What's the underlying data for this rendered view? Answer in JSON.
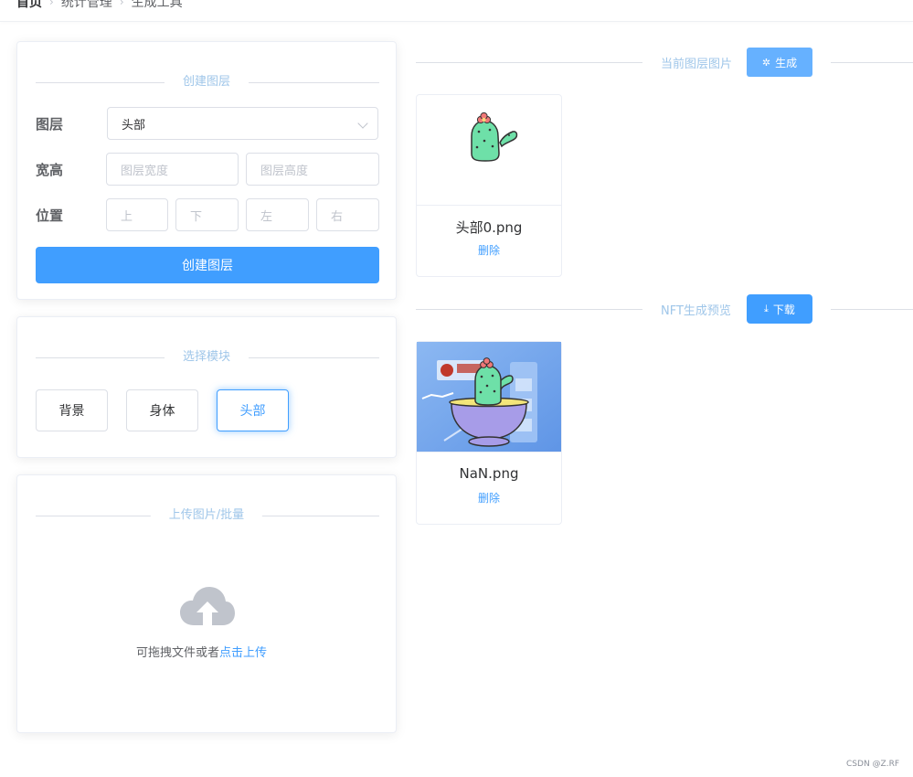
{
  "breadcrumb": {
    "home": "首页",
    "items": [
      "统计管理",
      "生成工具"
    ]
  },
  "create_layer": {
    "section_title": "创建图层",
    "layer_label": "图层",
    "layer_value": "头部",
    "size_label": "宽高",
    "width_placeholder": "图层宽度",
    "height_placeholder": "图层高度",
    "position_label": "位置",
    "pos_top": "上",
    "pos_bottom": "下",
    "pos_left": "左",
    "pos_right": "右",
    "create_button": "创建图层"
  },
  "select_module": {
    "section_title": "选择模块",
    "buttons": [
      "背景",
      "身体",
      "头部"
    ],
    "active": "头部"
  },
  "upload": {
    "section_title": "上传图片/批量",
    "hint": "可拖拽文件或者",
    "link": "点击上传"
  },
  "current_layer": {
    "section_title": "当前图层图片",
    "generate_button": "生成",
    "image_name": "头部0.png",
    "delete": "删除"
  },
  "preview": {
    "section_title": "NFT生成预览",
    "download_button": "下载",
    "image_name": "NaN.png",
    "delete": "删除"
  },
  "watermark": "CSDN @Z.RF",
  "colors": {
    "primary": "#409eff",
    "primary_light": "#66b1ff",
    "divider_text": "#9fc6e9"
  }
}
